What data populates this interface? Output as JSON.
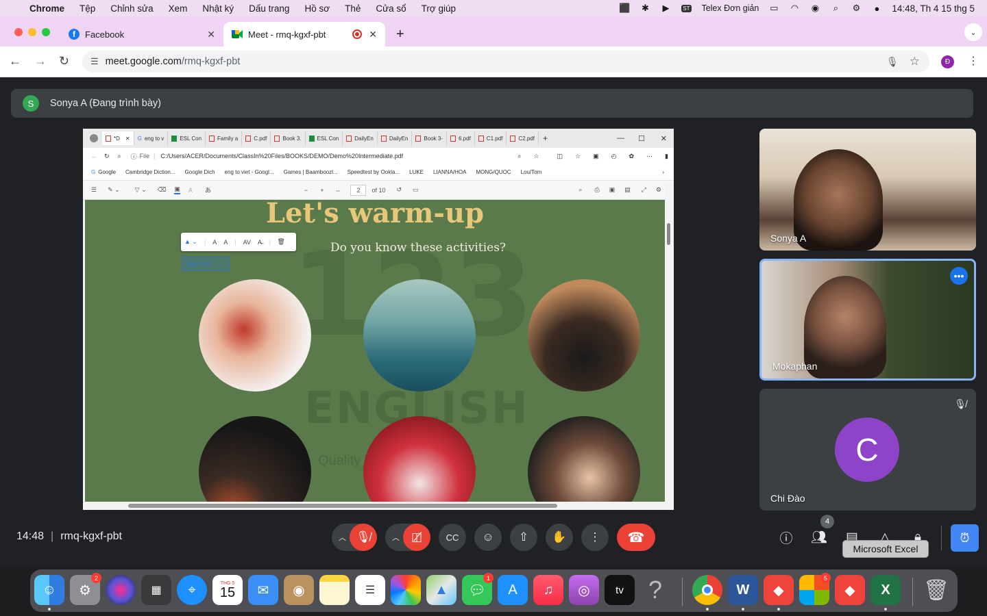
{
  "menubar": {
    "app": "Chrome",
    "items": [
      "Tệp",
      "Chỉnh sửa",
      "Xem",
      "Nhật ký",
      "Dấu trang",
      "Hồ sơ",
      "Thẻ",
      "Cửa sổ",
      "Trợ giúp"
    ],
    "input_method": "Telex Đơn giản",
    "datetime": "14:48, Th 4 15 thg 5",
    "input_badge": "ST"
  },
  "chrome": {
    "tabs": [
      {
        "title": "Facebook"
      },
      {
        "title": "Meet - rmq-kgxf-pbt"
      }
    ],
    "new_tab": "+",
    "url_host": "meet.google.com",
    "url_path": "/rmq-kgxf-pbt",
    "profile_initial": "Đ"
  },
  "meet": {
    "presenter_initial": "S",
    "presenter_text": "Sonya A (Đang trình bày)",
    "time": "14:48",
    "meeting_code": "rmq-kgxf-pbt",
    "people_count": "4",
    "tooltip": "Microsoft Excel",
    "participants": [
      {
        "name": "Sonya A"
      },
      {
        "name": "Mokaphan"
      },
      {
        "name": "Chi Đào",
        "initial": "C"
      }
    ]
  },
  "shared_screen": {
    "tabs": [
      "*D",
      "eng to v",
      "ESL Con",
      "Family a",
      "C.pdf",
      "Book 3.",
      "ESL Con",
      "DailyEn",
      "DailyEn",
      "Book 3-",
      "6.pdf",
      "C1.pdf",
      "C2.pdf"
    ],
    "address": "C:/Users/ACER/Documents/ClassIn%20Files/BOOKS/DEMO/Demo%20Intermediate.pdf",
    "address_prefix": "File",
    "bookmarks": [
      "Google",
      "Cambridge Diction...",
      "Google Dich",
      "eng to viet - Googl...",
      "Games | Baamboozl...",
      "Speedtest by Ookla...",
      "LUKE",
      "LIANNA/HOA",
      "MONG/QUOC",
      "Lou/Tom"
    ],
    "page_number": "2",
    "page_total": "of 10",
    "page_title": "Let's warm-up",
    "page_subtitle": "Do you know these activities?",
    "text_box": "Type text",
    "watermark_big": "123",
    "watermark_word": "ENGLISH",
    "watermark_tagline": "Quality  English  Courses"
  },
  "dock": {
    "calendar_month": "THG 5",
    "calendar_day": "15",
    "settings_badge": "2",
    "messages_badge": "1",
    "office_badge": "5",
    "tv_label": "tv",
    "help_glyph": "?",
    "word_letter": "W",
    "excel_letter": "X"
  }
}
